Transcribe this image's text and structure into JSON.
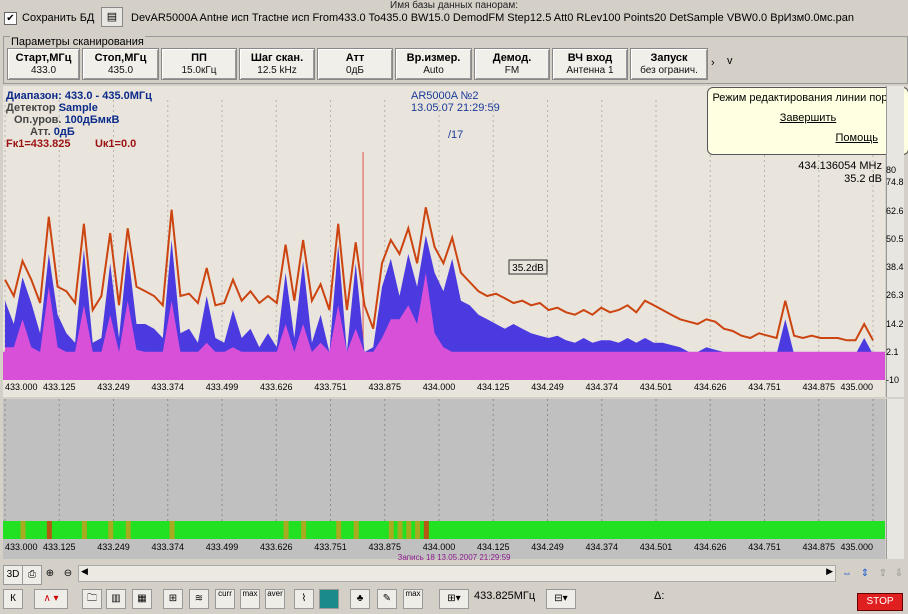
{
  "header": {
    "db_title": "Имя базы данных панорам:",
    "save_checked": "✔",
    "save_label": "Сохранить БД",
    "db_name": "DevAR5000A Antне исп Tractне исп From433.0 To435.0 BW15.0 DemodFM Step12.5 Att0 RLev100 Points20 DetSample VBW0.0 ВрИзм0.0мс.pan"
  },
  "params": {
    "title": "Параметры сканирования",
    "buttons": [
      {
        "label": "Старт,МГц",
        "value": "433.0"
      },
      {
        "label": "Стоп,МГц",
        "value": "435.0"
      },
      {
        "label": "ПП",
        "value": "15.0кГц"
      },
      {
        "label": "Шаг скан.",
        "value": "12.5 kHz"
      },
      {
        "label": "Атт",
        "value": "0дБ"
      },
      {
        "label": "Вр.измер.",
        "value": "Auto"
      },
      {
        "label": "Демод.",
        "value": "FM"
      },
      {
        "label": "ВЧ вход",
        "value": "Антенна 1"
      },
      {
        "label": "Запуск",
        "value": "без огранич."
      }
    ],
    "more_arrow": "›",
    "more_v": "v"
  },
  "info": {
    "range_label": "Диапазон:",
    "range_value": "433.0 - 435.0МГц",
    "detector_label": "Детектор",
    "detector_value": "Sample",
    "ref_label": "Оп.уров.",
    "ref_value": "100дБмкВ",
    "att_label": "Атт.",
    "att_value": "0дБ",
    "fk": "Fк1=433.825",
    "uk": "Uк1=0.0",
    "device": "AR5000A №2",
    "datetime": "13.05.07 21:29:59",
    "fraction": "/17"
  },
  "popup": {
    "title": "Режим редактирования линии порога",
    "finish": "Завершить",
    "help": "Помощь"
  },
  "marker": {
    "freq": "434.136054 MHz",
    "db": "35.2 dB",
    "box": "35.2dB"
  },
  "chart_data": {
    "type": "area",
    "x_ticks": [
      "433.000",
      "433.125",
      "433.249",
      "433.374",
      "433.499",
      "433.626",
      "433.751",
      "433.875",
      "434.000",
      "434.125",
      "434.249",
      "434.374",
      "434.501",
      "434.626",
      "434.751",
      "434.875",
      "435.000"
    ],
    "y_ticks": [
      "80",
      "74.8",
      "62.6",
      "50.5",
      "38.4",
      "26.3",
      "14.2",
      "2.1",
      "-10"
    ],
    "ylim": [
      -10,
      80
    ],
    "xlim": [
      433.0,
      435.0
    ],
    "marker_x": 433.825,
    "series": [
      {
        "color": "#cc4410",
        "values": [
          33,
          26,
          41,
          33,
          23,
          60,
          30,
          28,
          23,
          57,
          20,
          26,
          53,
          22,
          55,
          30,
          28,
          26,
          22,
          63,
          26,
          27,
          23,
          38,
          22,
          23,
          33,
          24,
          28,
          23,
          26,
          23,
          48,
          24,
          50,
          24,
          31,
          20,
          57,
          20,
          49,
          22,
          12,
          40,
          50,
          44,
          55,
          40,
          64,
          47,
          40,
          51,
          36,
          32,
          28,
          26,
          27,
          25,
          23,
          24,
          22,
          23,
          20,
          21,
          19,
          18,
          20,
          18,
          21,
          19,
          20,
          22,
          19,
          24,
          22,
          20,
          18,
          16,
          15,
          14,
          16,
          15,
          12,
          11,
          9,
          8,
          10,
          9,
          8,
          24,
          9,
          8,
          9,
          8,
          8,
          8,
          7,
          7,
          14,
          7
        ]
      },
      {
        "color": "#4a3ae0",
        "values": [
          24,
          14,
          34,
          23,
          10,
          44,
          18,
          10,
          6,
          46,
          6,
          8,
          40,
          8,
          46,
          14,
          14,
          12,
          8,
          50,
          10,
          12,
          6,
          26,
          8,
          6,
          20,
          8,
          12,
          4,
          10,
          4,
          36,
          8,
          41,
          6,
          18,
          2,
          48,
          2,
          40,
          2,
          4,
          30,
          42,
          26,
          44,
          30,
          52,
          36,
          28,
          42,
          24,
          22,
          18,
          16,
          14,
          12,
          14,
          12,
          10,
          9,
          8,
          9,
          7,
          6,
          8,
          6,
          7,
          7,
          6,
          8,
          6,
          8,
          6,
          6,
          5,
          4,
          2,
          2,
          4,
          3,
          2,
          1,
          1,
          1,
          2,
          1,
          1,
          16,
          1,
          1,
          1,
          1,
          1,
          1,
          1,
          1,
          8,
          1
        ]
      },
      {
        "color": "#d850d8",
        "values": [
          4,
          4,
          16,
          4,
          2,
          30,
          4,
          2,
          2,
          22,
          2,
          2,
          18,
          2,
          24,
          3,
          2,
          2,
          2,
          24,
          2,
          2,
          2,
          6,
          2,
          2,
          4,
          2,
          2,
          2,
          2,
          2,
          14,
          2,
          14,
          2,
          6,
          2,
          22,
          2,
          12,
          2,
          2,
          8,
          16,
          16,
          22,
          14,
          36,
          10,
          4,
          2,
          2,
          2,
          2,
          2,
          2,
          2,
          2,
          2,
          2,
          2,
          2,
          2,
          2,
          2,
          2,
          2,
          2,
          2,
          2,
          2,
          2,
          2,
          2,
          2,
          2,
          2,
          2,
          2,
          2,
          2,
          2,
          2,
          2,
          2,
          2,
          2,
          2,
          2,
          2,
          2,
          2,
          2,
          2,
          2,
          2,
          2,
          2,
          2
        ]
      }
    ]
  },
  "waterfall": {
    "caption": "Запись 18 13.05.2007 21:29:59"
  },
  "bottom": {
    "freq": "433.825МГц",
    "delta": "Δ:",
    "stop": "STOP"
  }
}
